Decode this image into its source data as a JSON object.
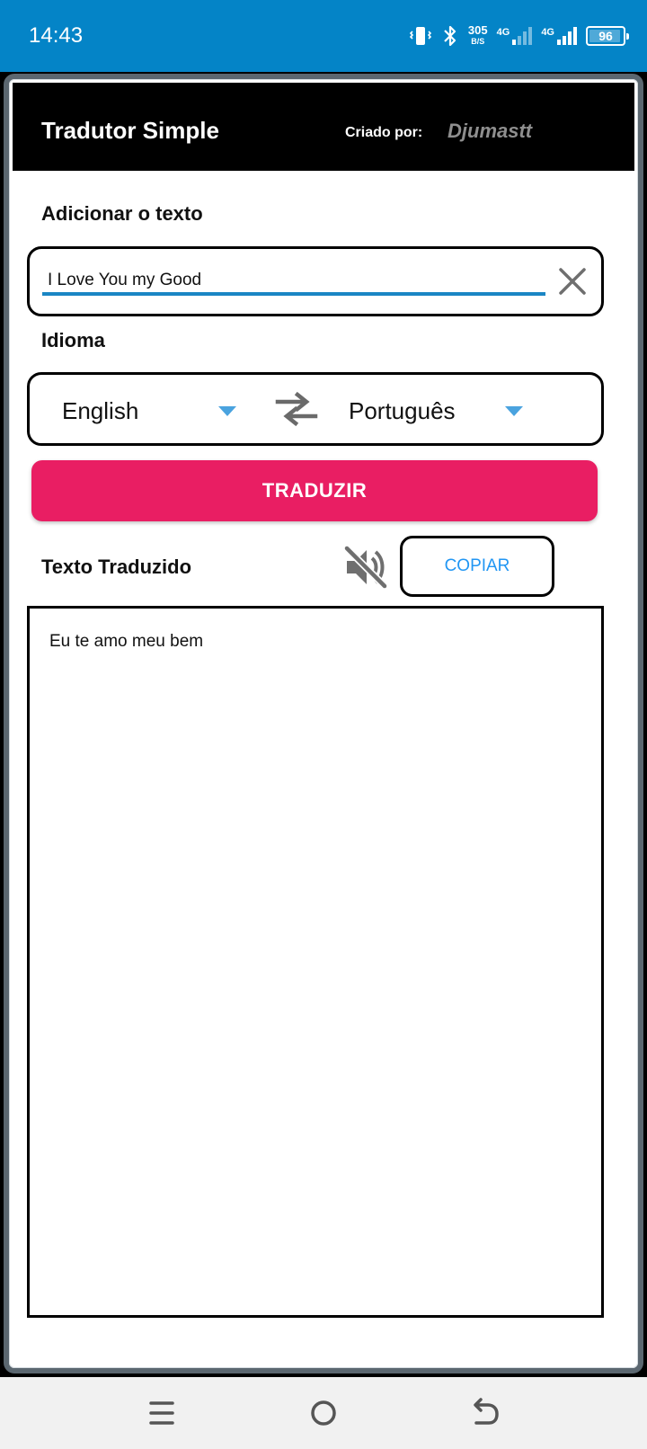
{
  "status_bar": {
    "time": "14:43",
    "net_speed_value": "305",
    "net_speed_unit": "B/S",
    "sim1_label": "4G",
    "sim2_label": "4G",
    "battery": "96"
  },
  "app_bar": {
    "title": "Tradutor Simple",
    "creator_label": "Criado por:",
    "creator_name": "Djumastt"
  },
  "input_section": {
    "label": "Adicionar o texto",
    "value": "I Love You my Good"
  },
  "language_section": {
    "label": "Idioma",
    "source_language": "English",
    "target_language": "Português"
  },
  "translate_button": {
    "label": "TRADUZIR"
  },
  "output_section": {
    "label": "Texto Traduzido",
    "copy_label": "COPIAR",
    "translated_text": "Eu te amo meu bem"
  },
  "colors": {
    "status_bar": "#0484c7",
    "app_bar": "#000000",
    "accent_pink": "#e91e63",
    "copy_blue": "#2196f3",
    "input_underline": "#1a86c4",
    "dropdown_caret": "#4aa3df"
  },
  "icons": {
    "clear": "close-icon",
    "swap": "swap-horizontal-icon",
    "speaker": "volume-off-icon",
    "nav_menu": "menu-icon",
    "nav_home": "home-icon",
    "nav_back": "back-icon"
  }
}
